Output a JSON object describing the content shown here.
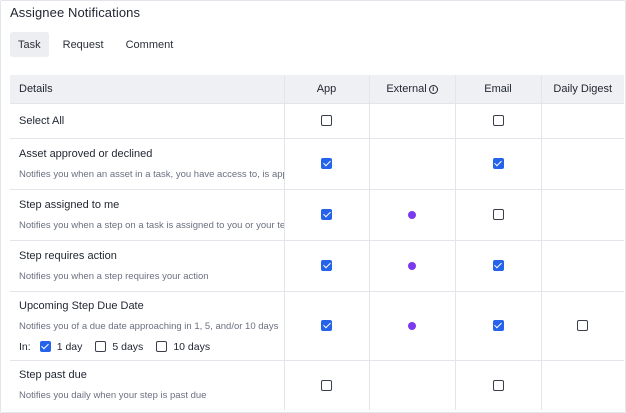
{
  "heading": "Assignee Notifications",
  "tabs": [
    {
      "label": "Task",
      "active": true
    },
    {
      "label": "Request",
      "active": false
    },
    {
      "label": "Comment",
      "active": false
    }
  ],
  "columns": {
    "details": "Details",
    "app": "App",
    "external": "External",
    "email": "Email",
    "digest": "Daily Digest"
  },
  "rows": [
    {
      "title": "Select All",
      "desc": "",
      "app": false,
      "external": null,
      "email": false,
      "digest": null
    },
    {
      "title": "Asset approved or declined",
      "desc": "Notifies you when an asset in a task, you have access to, is approved or declined",
      "app": true,
      "external": null,
      "email": true,
      "digest": null
    },
    {
      "title": "Step assigned to me",
      "desc": "Notifies you when a step on a task is assigned to you or your team",
      "app": true,
      "external": "dot",
      "email": false,
      "digest": null
    },
    {
      "title": "Step requires action",
      "desc": "Notifies you when a step requires your action",
      "app": true,
      "external": "dot",
      "email": true,
      "digest": null
    },
    {
      "title": "Upcoming Step Due Date",
      "desc": "Notifies you of a due date approaching in 1, 5, and/or 10 days",
      "app": true,
      "external": "dot",
      "email": true,
      "digest": false
    },
    {
      "title": "Step past due",
      "desc": "Notifies you daily when your step is past due",
      "app": false,
      "external": null,
      "email": false,
      "digest": null
    }
  ],
  "due_options": {
    "label": "In:",
    "options": [
      {
        "label": "1 day",
        "checked": true
      },
      {
        "label": "5 days",
        "checked": false
      },
      {
        "label": "10 days",
        "checked": false
      }
    ]
  },
  "colors": {
    "accent": "#2563eb",
    "external_dot": "#7c3aed",
    "header_bg": "#eef0f3"
  },
  "icons": {
    "external_info": "info-circle-icon"
  }
}
